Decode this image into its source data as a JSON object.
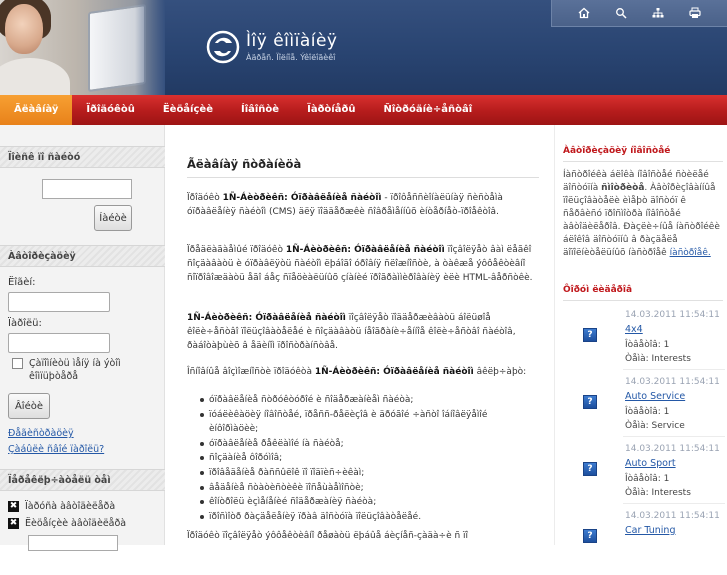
{
  "header": {
    "site_title": "Ìîÿ êîìïàíèÿ",
    "site_slogan": "Àäðåñ. Ïîëíîå. Ýêîëîãèêî",
    "toolbar": [
      {
        "icon": "home-icon"
      },
      {
        "icon": "search-icon"
      },
      {
        "icon": "sitemap-icon"
      },
      {
        "icon": "print-icon"
      }
    ]
  },
  "nav": {
    "items": [
      {
        "label": "Ãëàâíàÿ",
        "active": true
      },
      {
        "label": "Ïðîäóêòû",
        "active": false
      },
      {
        "label": "Ëèöåíçèè",
        "active": false
      },
      {
        "label": "Íîâîñòè",
        "active": false
      },
      {
        "label": "Ïàðòíåðû",
        "active": false
      },
      {
        "label": "Ñîòðóäíè÷åñòâî",
        "active": false
      }
    ]
  },
  "left": {
    "search_title": "Ïîèñê ïî ñàéòó",
    "search_button": "Íàéòè",
    "auth_title": "Àâòîðèçàöèÿ",
    "login_label": "Ëîãèí:",
    "password_label": "Ïàðîëü:",
    "remember_label": "Çàïîìíèòü ìåíÿ íà ýòîì êîìïüþòåðå",
    "login_button": "Âîéòè",
    "register_link": "Ðåãèñòðàöèÿ",
    "forgot_link": "Çàáûëè ñâîé ïàðîëü?",
    "themes_title": "Ïåðåêëþ÷àòåëü òåì",
    "theme_options": [
      "Ïàðóñà àâòîäèëåðà",
      "Ëèöåíçèè àâòîäèëåðà"
    ]
  },
  "main": {
    "title": "Ãëàâíàÿ ñòðàíèöà",
    "para1_bold": "1Ñ-Áèòðèêñ: Óïðàâëåíèå ñàéòîì",
    "para1_pre": "Ïðîäóêò ",
    "para1_post": " - ïðîôåññèîíàëüíàÿ ñèñòåìà óïðàâëåíèÿ ñàéòîì (CMS) äëÿ ïîääåðæêè ñîâðåìåííûõ èíòåðíåò-ïðîåêòîâ.",
    "para2_pre": "Ïðåäëàãàåìûé ïðîäóêò ",
    "para2_bold": "1Ñ-Áèòðèêñ: Óïðàâëåíèå ñàéòîì",
    "para2_post": " ïîçâîëÿåò âàì ëåãêî ñîçäàâàòü è óïðàâëÿòü ñàéòîì ëþáîãî óðîâíÿ ñëîæíîñòè, à òàêæå ýôôåêòèâíî ñîïðîâîæäàòü åãî áåç ñïåöèàëüíûõ çíàíèé ïðîãðàììèðîâàíèÿ èëè HTML-âåðñòêè.",
    "para3_bold": "1Ñ-Áèòðèêñ: Óïðàâëåíèå ñàéòîì",
    "para3_post": " ïîçâîëÿåò ïîääåðæèâàòü áîëüøîå êîëè÷åñòâî ïîëüçîâàòåëåé è ñîçäàâàòü íåîãðàíè÷åííîå êîëè÷åñòâî ñàéòîâ, ðàáîòàþùèõ â åäèíîì ïðîñòðàíñòâå.",
    "para4_pre": "Îñíîâíûå âîçìîæíîñòè ïðîäóêòà ",
    "para4_bold": "1Ñ-Áèòðèêñ: Óïðàâëåíèå ñàéòîì",
    "para4_post": " âêëþ÷àþò:",
    "bullets": [
      "óïðàâëåíèå ñòðóêòóðîé è ñîäåðæàíèåì ñàéòà;",
      "ïóáëèêàöèÿ íîâîñòåé, ïðåññ-ðåëèçîâ è äðóãîé ÷àñòî îáíîâëÿåìîé èíôîðìàöèè;",
      "óïðàâëåíèå ðåêëàìîé íà ñàéòå;",
      "ñîçäàíèå ôîðóìîâ;",
      "ïðîâåäåíèå ðàññûëîê ïî ïîäïèñ÷èêàì;",
      "âåäåíèå ñòàòèñòèêè ïîñåùàåìîñòè;",
      "êîíòðîëü èçìåíåíèé ñîäåðæàíèÿ ñàéòà;",
      "ïðîñìîòð ðàçäåëåíèÿ ïðàâ äîñòóïà ïîëüçîâàòåëåé."
    ],
    "para5": "Ïðîäóêò ïîçâîëÿåò ýôôåêòèâíî ðåøàòü ëþáûå áèçíåñ-çàäà÷è ñ ïî"
  },
  "right": {
    "info_title": "Àâòîðèçàöèÿ íîâîñòåé",
    "info_text_pre": "Íàñòðîéêà áëîêà íîâîñòåé ñòèëåé äîñòóïíà ",
    "info_bold": "ñìîòðèòå",
    "info_text_mid": ". Àâòîðèçîâàííûå ïîëüçîâàòåëè èìåþò äîñòóï ê ñåðâèñó ïðîñìîòðà íîâîñòåé àâòîäèëåðîâ. Ðàçëè÷íûå íàñòðîéêè áëîêîâ äîñòóïíû â ðàçäåëå äîïîëíèòåëüíûõ íàñòðîåê ",
    "info_link": "íàñòðîåê.",
    "forum_title": "Ôîðóì ëèäåðîâ",
    "forum_items": [
      {
        "date": "14.03.2011 11:54:11",
        "link": "4x4",
        "answers_label": "Îòâåòîâ: 1",
        "theme_label": "Òåìà: Interests"
      },
      {
        "date": "14.03.2011 11:54:11",
        "link": "Auto Service",
        "answers_label": "Îòâåòîâ: 1",
        "theme_label": "Òåìà: Service"
      },
      {
        "date": "14.03.2011 11:54:11",
        "link": "Auto Sport",
        "answers_label": "Îòâåòîâ: 1",
        "theme_label": "Òåìà: Interests"
      },
      {
        "date": "14.03.2011 11:54:11",
        "link": "Car Tuning",
        "answers_label": "",
        "theme_label": ""
      }
    ]
  },
  "colors": {
    "header_blue": "#2c4675",
    "nav_red": "#b51c1c",
    "nav_active_orange": "#ef9428",
    "link_blue": "#2458a6",
    "right_title_red": "#c0181c"
  }
}
